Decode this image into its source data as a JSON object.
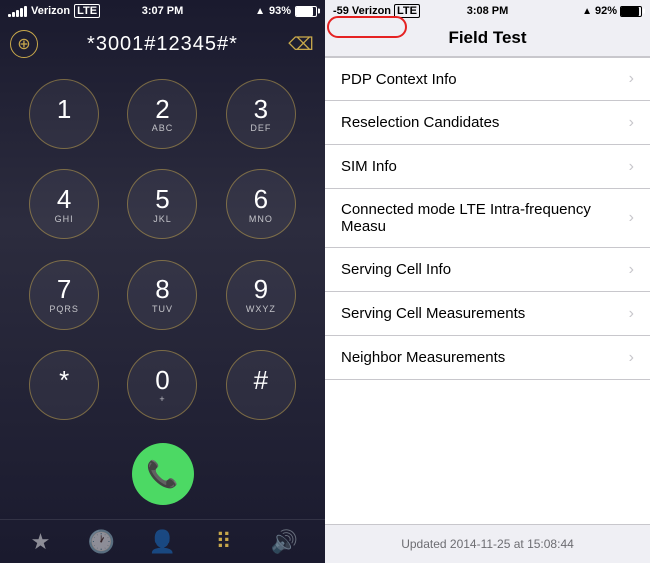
{
  "left": {
    "status_bar": {
      "carrier": "Verizon",
      "network": "LTE",
      "time": "3:07 PM",
      "battery_pct": "93%",
      "location_icon": "▲"
    },
    "dial_field": {
      "add_icon": "⊕",
      "number": "*3001#12345#*",
      "clear_icon": "⌫"
    },
    "keys": [
      {
        "main": "1",
        "sub": ""
      },
      {
        "main": "2",
        "sub": "ABC"
      },
      {
        "main": "3",
        "sub": "DEF"
      },
      {
        "main": "4",
        "sub": "GHI"
      },
      {
        "main": "5",
        "sub": "JKL"
      },
      {
        "main": "6",
        "sub": "MNO"
      },
      {
        "main": "7",
        "sub": "PQRS"
      },
      {
        "main": "8",
        "sub": "TUV"
      },
      {
        "main": "9",
        "sub": "WXYZ"
      },
      {
        "main": "*",
        "sub": ""
      },
      {
        "main": "0",
        "sub": "+"
      },
      {
        "main": "#",
        "sub": ""
      }
    ],
    "nav": {
      "items": [
        {
          "icon": "★",
          "name": "favorites",
          "active": false
        },
        {
          "icon": "🕐",
          "name": "recents",
          "active": false
        },
        {
          "icon": "👤",
          "name": "contacts",
          "active": false
        },
        {
          "icon": "⠿",
          "name": "keypad",
          "active": true
        },
        {
          "icon": "📢",
          "name": "voicemail",
          "active": false
        }
      ]
    }
  },
  "right": {
    "status_bar": {
      "carrier_signal": "-59",
      "carrier": "Verizon",
      "network": "LTE",
      "time": "3:08 PM",
      "location_icon": "▲",
      "battery_pct": "92%"
    },
    "title": "Field Test",
    "menu_items": [
      {
        "label": "PDP Context Info",
        "chevron": "›"
      },
      {
        "label": "Reselection Candidates",
        "chevron": "›"
      },
      {
        "label": "SIM Info",
        "chevron": "›"
      },
      {
        "label": "Connected mode LTE Intra-frequency Measu",
        "chevron": "›"
      },
      {
        "label": "Serving Cell Info",
        "chevron": "›"
      },
      {
        "label": "Serving Cell Measurements",
        "chevron": "›"
      },
      {
        "label": "Neighbor Measurements",
        "chevron": "›"
      }
    ],
    "footer": "Updated 2014-11-25 at 15:08:44"
  }
}
